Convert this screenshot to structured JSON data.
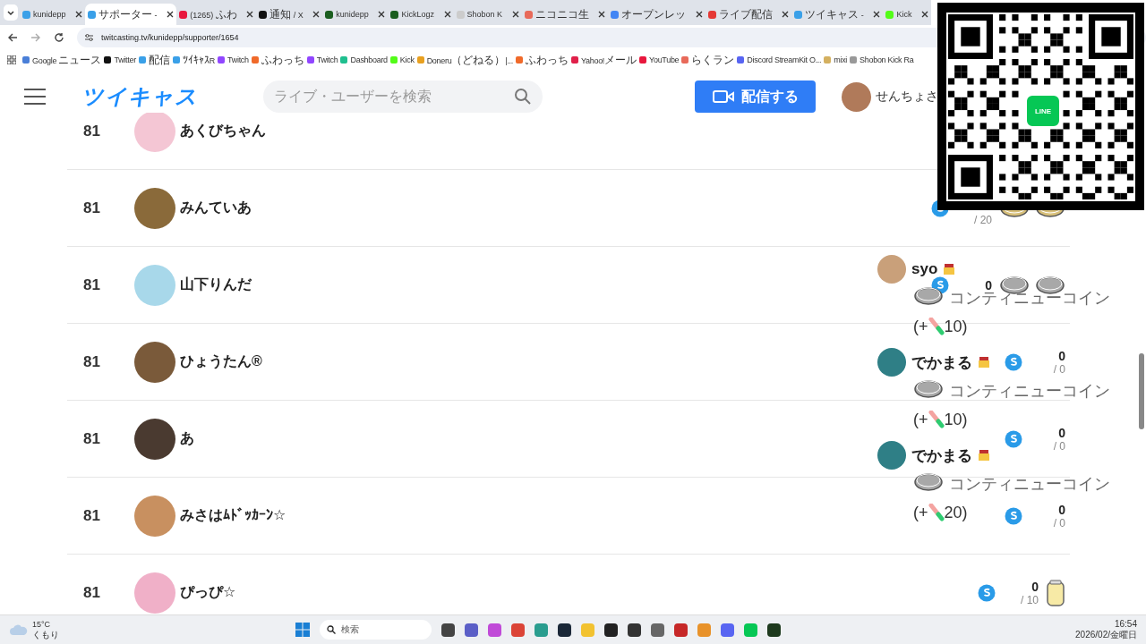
{
  "browser": {
    "tabs": [
      {
        "title": "kunidepp",
        "selected": false,
        "color": "#3aa0e8"
      },
      {
        "title": "サポーター -",
        "selected": true,
        "color": "#3aa0e8"
      },
      {
        "title": "(1265) ふわ",
        "selected": false,
        "color": "#e8173d"
      },
      {
        "title": "通知 / X",
        "selected": false,
        "color": "#111111"
      },
      {
        "title": "kunidepp",
        "selected": false,
        "color": "#1b5e20"
      },
      {
        "title": "KickLogz",
        "selected": false,
        "color": "#1b5e20"
      },
      {
        "title": "Shobon K",
        "selected": false,
        "color": "#cccccc"
      },
      {
        "title": "ニコニコ生",
        "selected": false,
        "color": "#e86a5a"
      },
      {
        "title": "オープンレッ",
        "selected": false,
        "color": "#4285f4"
      },
      {
        "title": "ライブ配信",
        "selected": false,
        "color": "#e53935"
      },
      {
        "title": "ツイキャス -",
        "selected": false,
        "color": "#3aa0e8"
      },
      {
        "title": "Kick",
        "selected": false,
        "color": "#53fc18"
      }
    ],
    "address": "twitcasting.tv/kunidepp/supporter/1654",
    "bookmarks": [
      {
        "label": "Google ニュース",
        "color": "#4a7fd8"
      },
      {
        "label": "Twitter",
        "color": "#111111"
      },
      {
        "label": "配信",
        "color": "#3aa0e8"
      },
      {
        "label": "ﾂｲｷｬｽR",
        "color": "#3aa0e8"
      },
      {
        "label": "Twitch",
        "color": "#9146ff"
      },
      {
        "label": "ふわっち",
        "color": "#f06a2a"
      },
      {
        "label": "Twitch",
        "color": "#9146ff"
      },
      {
        "label": "Dashboard",
        "color": "#1fbf8f"
      },
      {
        "label": "Kick",
        "color": "#53fc18"
      },
      {
        "label": "Doneru（どねる）|...",
        "color": "#e8a020"
      },
      {
        "label": "ふわっち",
        "color": "#f06a2a"
      },
      {
        "label": "Yahoo!メール",
        "color": "#e0204a"
      },
      {
        "label": "YouTube",
        "color": "#e8173d"
      },
      {
        "label": "らくラン",
        "color": "#e86a5a"
      },
      {
        "label": "Discord StreamKit O...",
        "color": "#5865f2"
      },
      {
        "label": "mixi",
        "color": "#d4b060"
      },
      {
        "label": "Shobon Kick Ra",
        "color": "#999999"
      }
    ]
  },
  "site_header": {
    "logo": "ツイキャス",
    "search": {
      "placeholder": "ライブ・ユーザーを検索"
    },
    "broadcast_button": "配信する",
    "user_name": "せんちょさ"
  },
  "supporters": [
    {
      "rank": "81",
      "name": "あくびちゃん",
      "color": "#f4c6d4"
    },
    {
      "rank": "81",
      "name": "みんていあ",
      "color": "#8a6a3a",
      "limit": "/ 20",
      "kind": "gold_coins"
    },
    {
      "rank": "81",
      "name": "山下りんだ",
      "color": "#a8d8ea",
      "points": "0",
      "kind": "silver_coins"
    },
    {
      "rank": "81",
      "name": "ひょうたん®",
      "color": "#7a5a3a",
      "points": "0",
      "limit": "/ 0"
    },
    {
      "rank": "81",
      "name": "あ",
      "color": "#4a3a30",
      "points": "0",
      "limit": "/ 0"
    },
    {
      "rank": "81",
      "name": "みさはﾑﾄﾞｯｶｰﾝ☆",
      "color": "#c89060",
      "points": "0",
      "limit": "/ 0"
    },
    {
      "rank": "81",
      "name": "ぴっぴ☆",
      "color": "#f0b0c8",
      "points": "0",
      "limit": "/ 10",
      "kind": "jar"
    }
  ],
  "overlay": {
    "entries": [
      {
        "name": "syo",
        "color": "#c9a07a",
        "gift": "コンティニューコイン",
        "prefix": "(+",
        "amount": "10)"
      },
      {
        "name": "でかまる",
        "color": "#2f7f86",
        "gift": "コンティニューコイン",
        "prefix": "(+",
        "amount": "10)"
      },
      {
        "name": "でかまる",
        "color": "#2f7f86",
        "gift": "コンティニューコイン",
        "prefix": "(+",
        "amount": "20)"
      }
    ]
  },
  "qr_code": {
    "logo": "LINE"
  },
  "taskbar": {
    "temperature": "15°C",
    "weather": "くもり",
    "search": "検索",
    "apps": [
      {
        "color": "#444444"
      },
      {
        "color": "#5b5fc7"
      },
      {
        "color": "#c04ad8"
      },
      {
        "color": "#db4437"
      },
      {
        "color": "#2a9d8f"
      },
      {
        "color": "#1b2838"
      },
      {
        "color": "#f2c230"
      },
      {
        "color": "#222222"
      },
      {
        "color": "#333333"
      },
      {
        "color": "#666666"
      },
      {
        "color": "#c62828"
      },
      {
        "color": "#e8922a"
      },
      {
        "color": "#5865f2"
      },
      {
        "color": "#06c755"
      },
      {
        "color": "#1e3a1e"
      }
    ],
    "time": "16:54",
    "date": "2026/02/金曜日"
  }
}
